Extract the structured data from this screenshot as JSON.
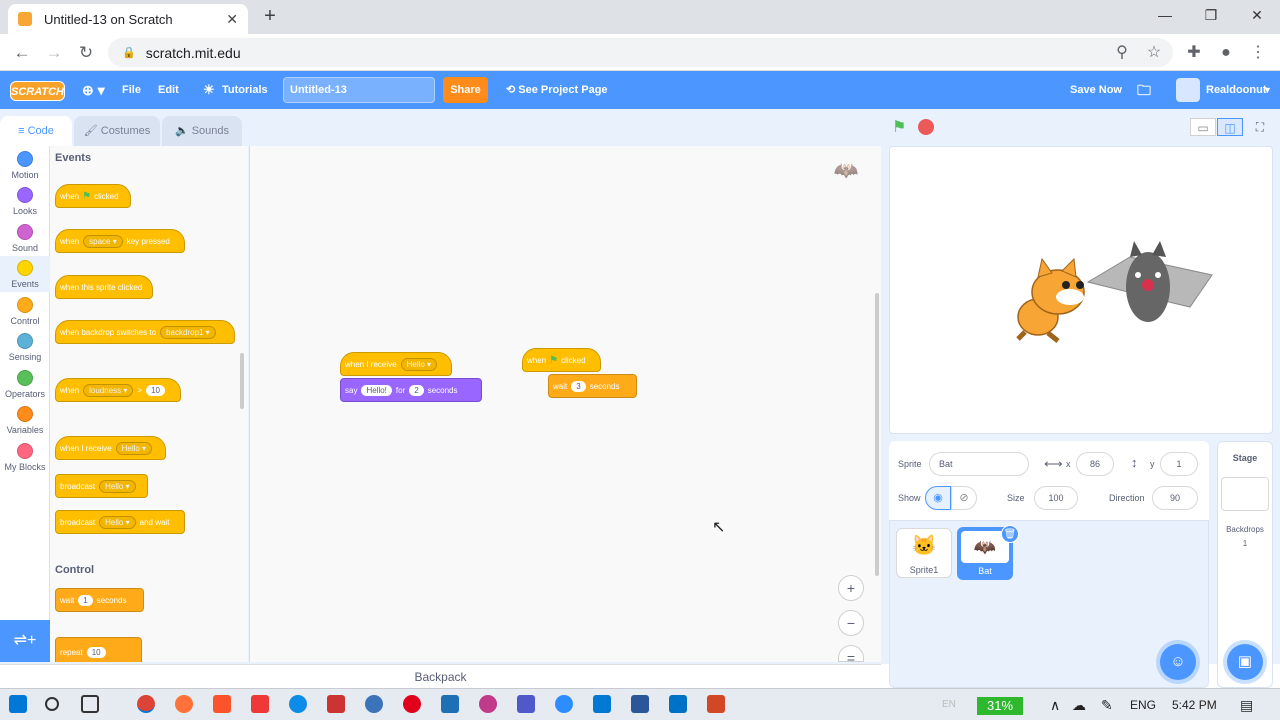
{
  "browser": {
    "tab_title": "Untitled-13 on Scratch",
    "url": "scratch.mit.edu"
  },
  "menubar": {
    "logo": "SCRATCH",
    "file": "File",
    "edit": "Edit",
    "tutorials": "Tutorials",
    "project_title": "Untitled-13",
    "share": "Share",
    "see_project_page": "See Project Page",
    "save_now": "Save Now",
    "username": "Realdoonut"
  },
  "tabs": {
    "code": "Code",
    "costumes": "Costumes",
    "sounds": "Sounds"
  },
  "categories": [
    {
      "label": "Motion",
      "color": "#4c97ff"
    },
    {
      "label": "Looks",
      "color": "#9966ff"
    },
    {
      "label": "Sound",
      "color": "#cf63cf"
    },
    {
      "label": "Events",
      "color": "#ffd500"
    },
    {
      "label": "Control",
      "color": "#ffab19"
    },
    {
      "label": "Sensing",
      "color": "#5cb1d6"
    },
    {
      "label": "Operators",
      "color": "#59c059"
    },
    {
      "label": "Variables",
      "color": "#ff8c1a"
    },
    {
      "label": "My Blocks",
      "color": "#ff6680"
    }
  ],
  "palette": {
    "events_heading": "Events",
    "control_heading": "Control",
    "when": "when",
    "clicked": "clicked",
    "space": "space",
    "key_pressed": "key pressed",
    "sprite_clicked": "when this sprite clicked",
    "backdrop_switches": "when backdrop switches to",
    "backdrop1": "backdrop1",
    "loudness": "loudness",
    "gt": ">",
    "ten": "10",
    "when_i_receive": "when I receive",
    "hello": "Hello",
    "broadcast": "broadcast",
    "and_wait": "and wait",
    "wait": "wait",
    "one": "1",
    "seconds": "seconds",
    "repeat": "repeat"
  },
  "script1": {
    "when_i_receive": "when I receive",
    "message": "Hello",
    "say": "say",
    "say_text": "Hello!",
    "for": "for",
    "secs": "2",
    "seconds": "seconds"
  },
  "script2": {
    "when": "when",
    "clicked": "clicked",
    "wait": "wait",
    "secs": "3",
    "seconds": "seconds"
  },
  "backpack": "Backpack",
  "sprite_info": {
    "sprite_label": "Sprite",
    "sprite_name": "Bat",
    "x_label": "x",
    "x_value": "86",
    "y_label": "y",
    "y_value": "1",
    "show_label": "Show",
    "size_label": "Size",
    "size_value": "100",
    "direction_label": "Direction",
    "direction_value": "90"
  },
  "sprites": [
    {
      "name": "Sprite1"
    },
    {
      "name": "Bat"
    }
  ],
  "stage_pane": {
    "title": "Stage",
    "backdrops_label": "Backdrops",
    "backdrops_count": "1"
  },
  "taskbar": {
    "battery": "31%",
    "lang": "ENG",
    "time": "5:42 PM",
    "en": "EN"
  }
}
